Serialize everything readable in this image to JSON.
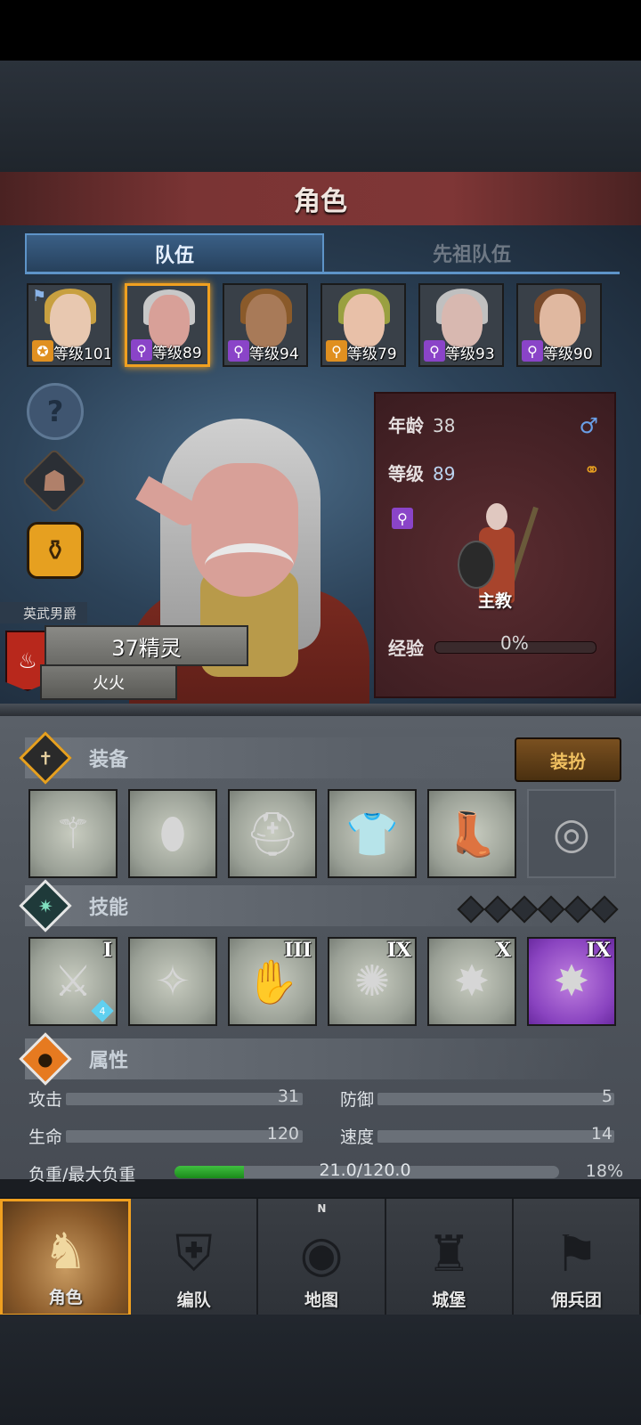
{
  "header": {
    "title": "角色"
  },
  "tabs": [
    {
      "label": "队伍",
      "active": true
    },
    {
      "label": "先祖队伍",
      "active": false
    }
  ],
  "roster": [
    {
      "level_text": "等级101",
      "class_icon": "flame-shield-icon",
      "hair_color": "#c8a040",
      "skin_color": "#e8c8b0",
      "has_flag": true,
      "gold_badge": true
    },
    {
      "level_text": "等级89",
      "class_icon": "staff-icon",
      "hair_color": "#c8c8c8",
      "skin_color": "#d8a098",
      "has_flag": false,
      "gold_badge": false,
      "selected": true
    },
    {
      "level_text": "等级94",
      "class_icon": "staff-icon",
      "hair_color": "#8a5a2a",
      "skin_color": "#a87a58",
      "has_flag": false,
      "gold_badge": false
    },
    {
      "level_text": "等级79",
      "class_icon": "staff-icon",
      "hair_color": "#9aa040",
      "skin_color": "#e8c0a8",
      "has_flag": false,
      "gold_badge": true
    },
    {
      "level_text": "等级93",
      "class_icon": "staff-icon",
      "hair_color": "#c0c0c0",
      "skin_color": "#d8b8b0",
      "has_flag": false,
      "gold_badge": false
    },
    {
      "level_text": "等级90",
      "class_icon": "staff-icon",
      "hair_color": "#7a4a2a",
      "skin_color": "#e0b8a0",
      "has_flag": false,
      "gold_badge": false
    }
  ],
  "side_icons": [
    "help-icon",
    "character-silhouette-icon",
    "potion-icon"
  ],
  "character": {
    "title": "英武男爵",
    "race": "37精灵",
    "element": "火火",
    "age_label": "年龄",
    "age": "38",
    "level_label": "等级",
    "level": "89",
    "role": "主教",
    "exp_label": "经验",
    "exp_value": "0%"
  },
  "equipment": {
    "label": "装备",
    "dress_button": "装扮",
    "slots": [
      {
        "name": "staff-weapon",
        "glyph": "⚚"
      },
      {
        "name": "shield",
        "glyph": "⬮"
      },
      {
        "name": "hood",
        "glyph": "⛑"
      },
      {
        "name": "tunic",
        "glyph": "👕"
      },
      {
        "name": "boots",
        "glyph": "👢"
      },
      {
        "name": "ring-empty",
        "glyph": "◎",
        "empty": true
      }
    ]
  },
  "skills": {
    "label": "技能",
    "slots": [
      {
        "rank": "I",
        "glyph": "⚔",
        "gem": "4"
      },
      {
        "rank": "",
        "glyph": "✧",
        "gem": ""
      },
      {
        "rank": "III",
        "glyph": "✋",
        "gem": ""
      },
      {
        "rank": "IX",
        "glyph": "✺",
        "gem": ""
      },
      {
        "rank": "X",
        "glyph": "✸",
        "gem": ""
      },
      {
        "rank": "IX",
        "glyph": "✸",
        "gem": "",
        "purple": true
      }
    ]
  },
  "attributes": {
    "label": "属性",
    "attack_label": "攻击",
    "attack": "31",
    "defense_label": "防御",
    "defense": "5",
    "hp_label": "生命",
    "hp": "120",
    "speed_label": "速度",
    "speed": "14",
    "load_label": "负重/最大负重",
    "load_text": "21.0/120.0",
    "load_percent": "18%",
    "load_fraction": 0.18
  },
  "nav": [
    {
      "label": "角色",
      "active": true,
      "icon": "knight-icon"
    },
    {
      "label": "编队",
      "active": false,
      "icon": "formation-icon"
    },
    {
      "label": "地图",
      "active": false,
      "icon": "compass-map-icon"
    },
    {
      "label": "城堡",
      "active": false,
      "icon": "castle-icon"
    },
    {
      "label": "佣兵团",
      "active": false,
      "icon": "mercenary-banner-icon"
    }
  ]
}
